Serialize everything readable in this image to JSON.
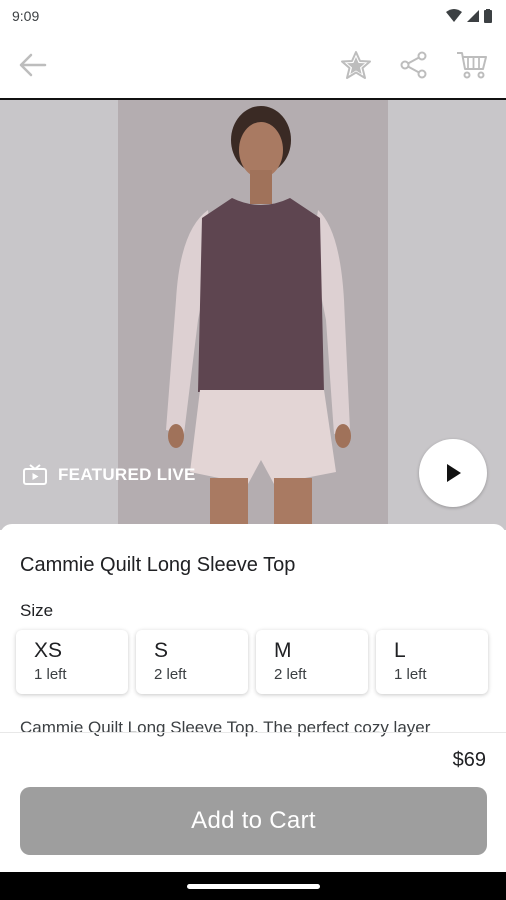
{
  "status_bar": {
    "time": "9:09"
  },
  "app_bar": {
    "back_icon": "arrow-left-icon",
    "favorite_icon": "star-icon",
    "share_icon": "share-icon",
    "cart_icon": "cart-icon"
  },
  "hero": {
    "badge_label": "FEATURED LIVE",
    "badge_icon": "tv-icon",
    "play_icon": "play-icon"
  },
  "product": {
    "title": "Cammie Quilt Long Sleeve Top",
    "size_label": "Size",
    "sizes": [
      {
        "name": "XS",
        "stock": "1 left"
      },
      {
        "name": "S",
        "stock": "2 left"
      },
      {
        "name": "M",
        "stock": "2 left"
      },
      {
        "name": "L",
        "stock": "1 left"
      }
    ],
    "description": "Cammie Quilt Long Sleeve Top. The perfect cozy layer",
    "price": "$69",
    "add_to_cart_label": "Add to Cart"
  },
  "colors": {
    "add_button": "#9e9e9e",
    "hero_bg": "#c8c6c9",
    "sweater": "#5e4550"
  }
}
